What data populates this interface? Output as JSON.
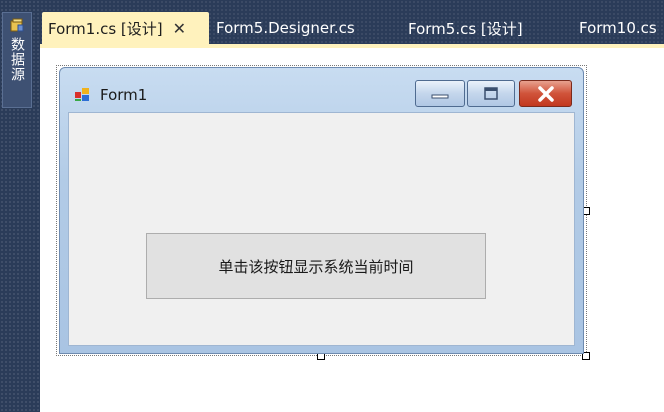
{
  "side_panel": {
    "label": "数据源",
    "icon": "database-icon"
  },
  "tabs": [
    {
      "label": "Form1.cs [设计]",
      "active": true,
      "close": "✕"
    },
    {
      "label": "Form5.Designer.cs",
      "active": false
    },
    {
      "label": "Form5.cs [设计]",
      "active": false
    },
    {
      "label": "Form10.cs",
      "active": false
    }
  ],
  "form": {
    "title": "Form1",
    "button_label": "单击该按钮显示系统当前时间"
  },
  "colors": {
    "ide_background": "#2b3c59",
    "active_tab": "#fff2bd",
    "close_button": "#c2381f",
    "client_area": "#f0f0f0"
  }
}
